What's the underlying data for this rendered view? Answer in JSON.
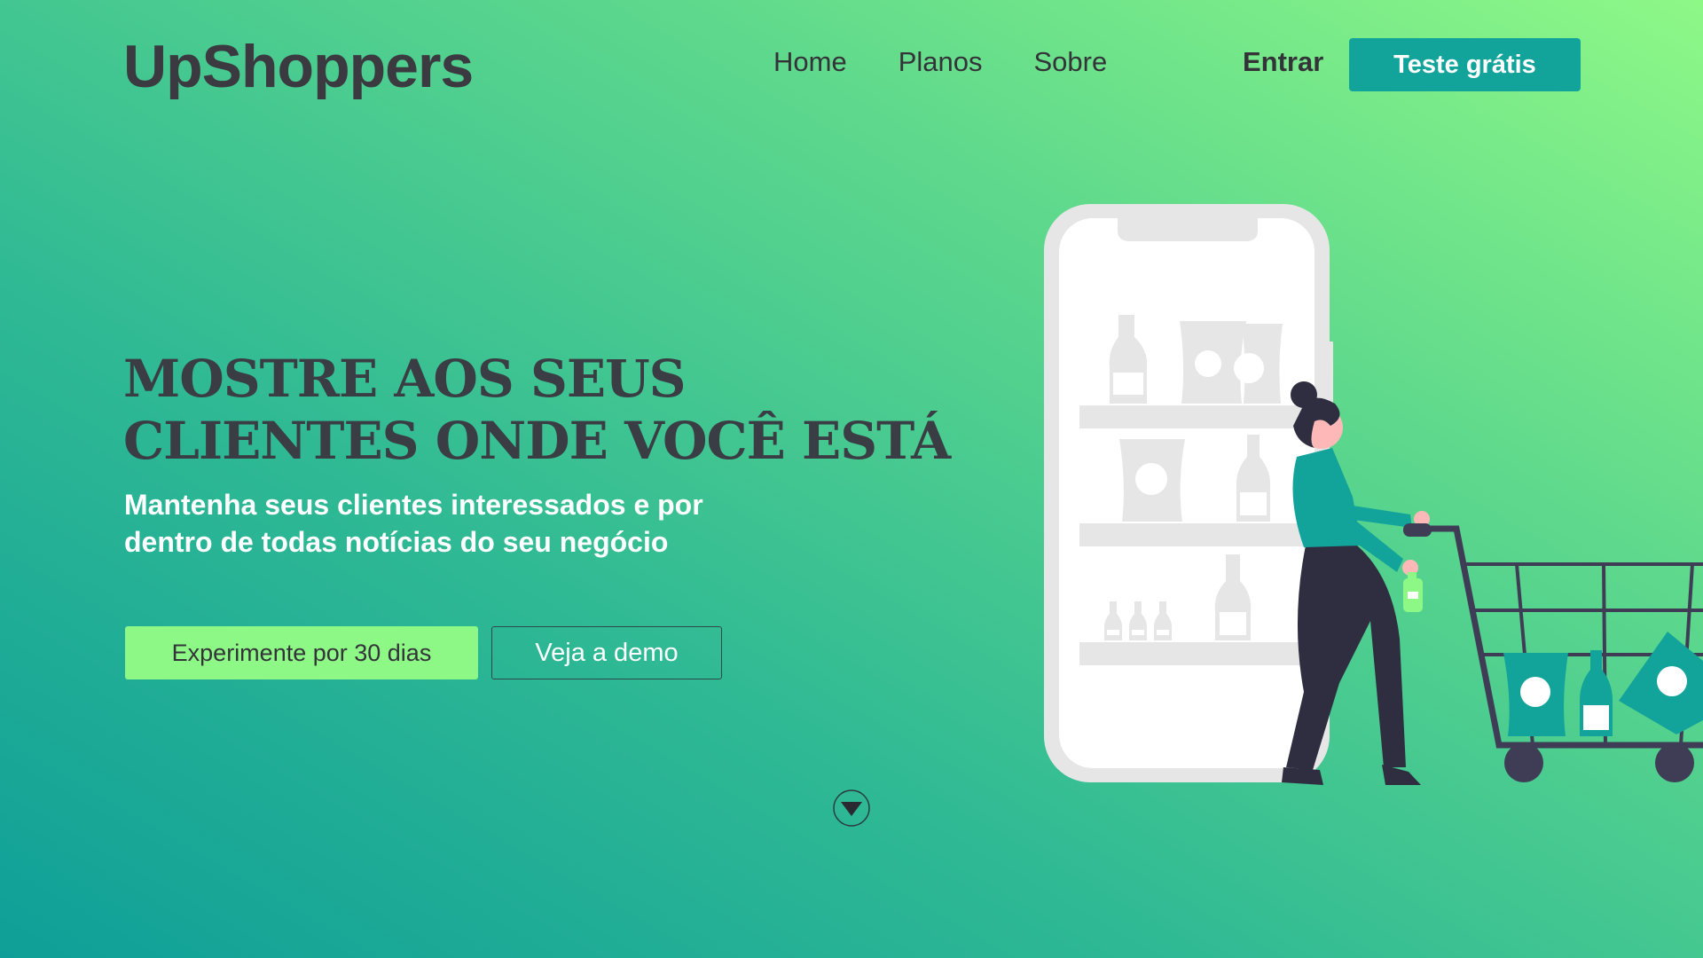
{
  "brand": {
    "logo_text": "UpShoppers"
  },
  "nav": {
    "items": [
      "Home",
      "Planos",
      "Sobre"
    ]
  },
  "header": {
    "login_label": "Entrar",
    "trial_label": "Teste grátis"
  },
  "hero": {
    "title_line1": "MOSTRE AOS SEUS",
    "title_line2": "CLIENTES ONDE VOCÊ ESTÁ",
    "subtitle_line1": "Mantenha seus clientes interessados e por",
    "subtitle_line2": "dentro de todas notícias do seu negócio",
    "primary_cta": "Experimente por 30 dias",
    "secondary_cta": "Veja a demo"
  },
  "icons": {
    "scroll": "chevron-down-icon",
    "illustration": "shopping-illustration"
  },
  "colors": {
    "accent": "#12a39b",
    "highlight": "#8ef887",
    "text_dark": "#3a3a40",
    "gradient_start": "#0f9f98",
    "gradient_end": "#8ef887"
  }
}
